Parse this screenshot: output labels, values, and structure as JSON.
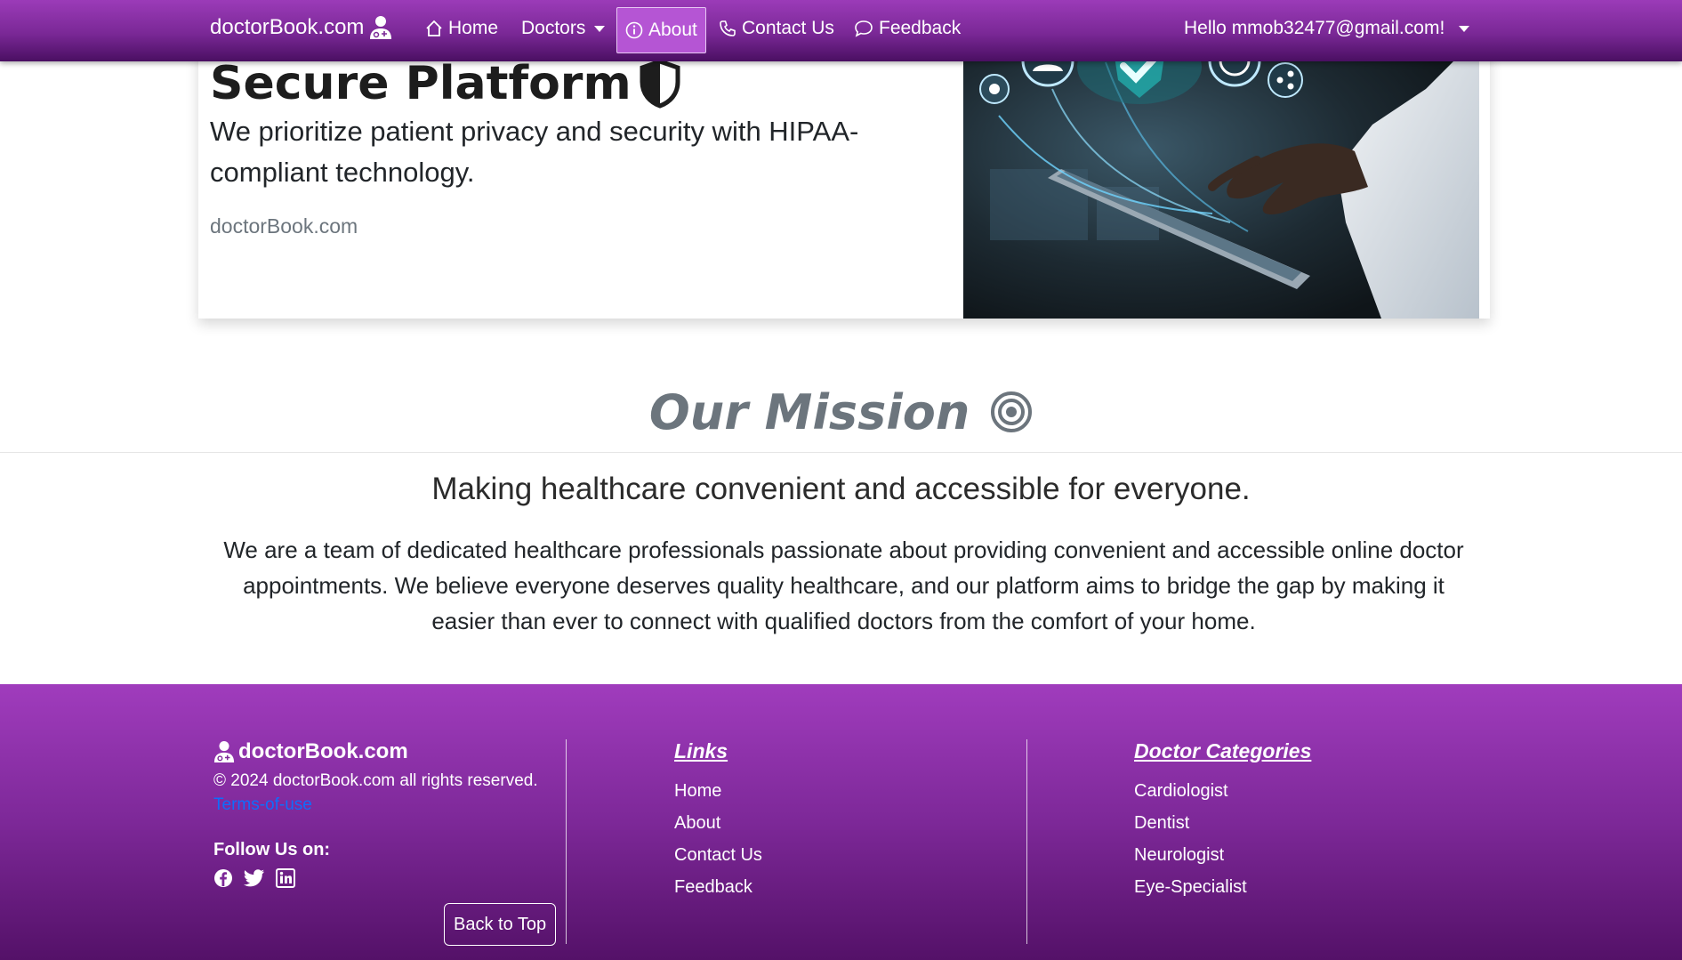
{
  "nav": {
    "brand": "doctorBook.com",
    "home": "Home",
    "doctors": "Doctors",
    "about": "About",
    "contact": "Contact Us",
    "feedback": "Feedback",
    "user_greeting": "Hello mmob32477@gmail.com!"
  },
  "card": {
    "title": "Secure Platform",
    "text": "We prioritize patient privacy and security with HIPAA-compliant technology.",
    "muted": "doctorBook.com"
  },
  "mission": {
    "title": "Our Mission",
    "lead": "Making healthcare convenient and accessible for everyone.",
    "body": "We are a team of dedicated healthcare professionals passionate about providing convenient and accessible online doctor appointments. We believe everyone deserves quality healthcare, and our platform aims to bridge the gap by making it easier than ever to connect with qualified doctors from the comfort of your home."
  },
  "footer": {
    "brand": "doctorBook.com",
    "copyright": "© 2024 doctorBook.com all rights reserved.",
    "terms": "Terms-of-use",
    "follow": "Follow Us on:",
    "back_to_top": "Back to Top",
    "links_title": "Links",
    "links": [
      "Home",
      "About",
      "Contact Us",
      "Feedback"
    ],
    "categories_title": "Doctor Categories",
    "categories": [
      "Cardiologist",
      "Dentist",
      "Neurologist",
      "Eye-Specialist"
    ],
    "social_icons": [
      "facebook-icon",
      "twitter-icon",
      "linkedin-icon"
    ]
  },
  "colors": {
    "nav_gradient_top": "#9b3bb8",
    "nav_gradient_bottom": "#4a0f62",
    "active_tab": "#b555d4",
    "terms_link": "#0d6efd",
    "footer_top": "#a03cbd",
    "footer_bottom": "#541168"
  }
}
